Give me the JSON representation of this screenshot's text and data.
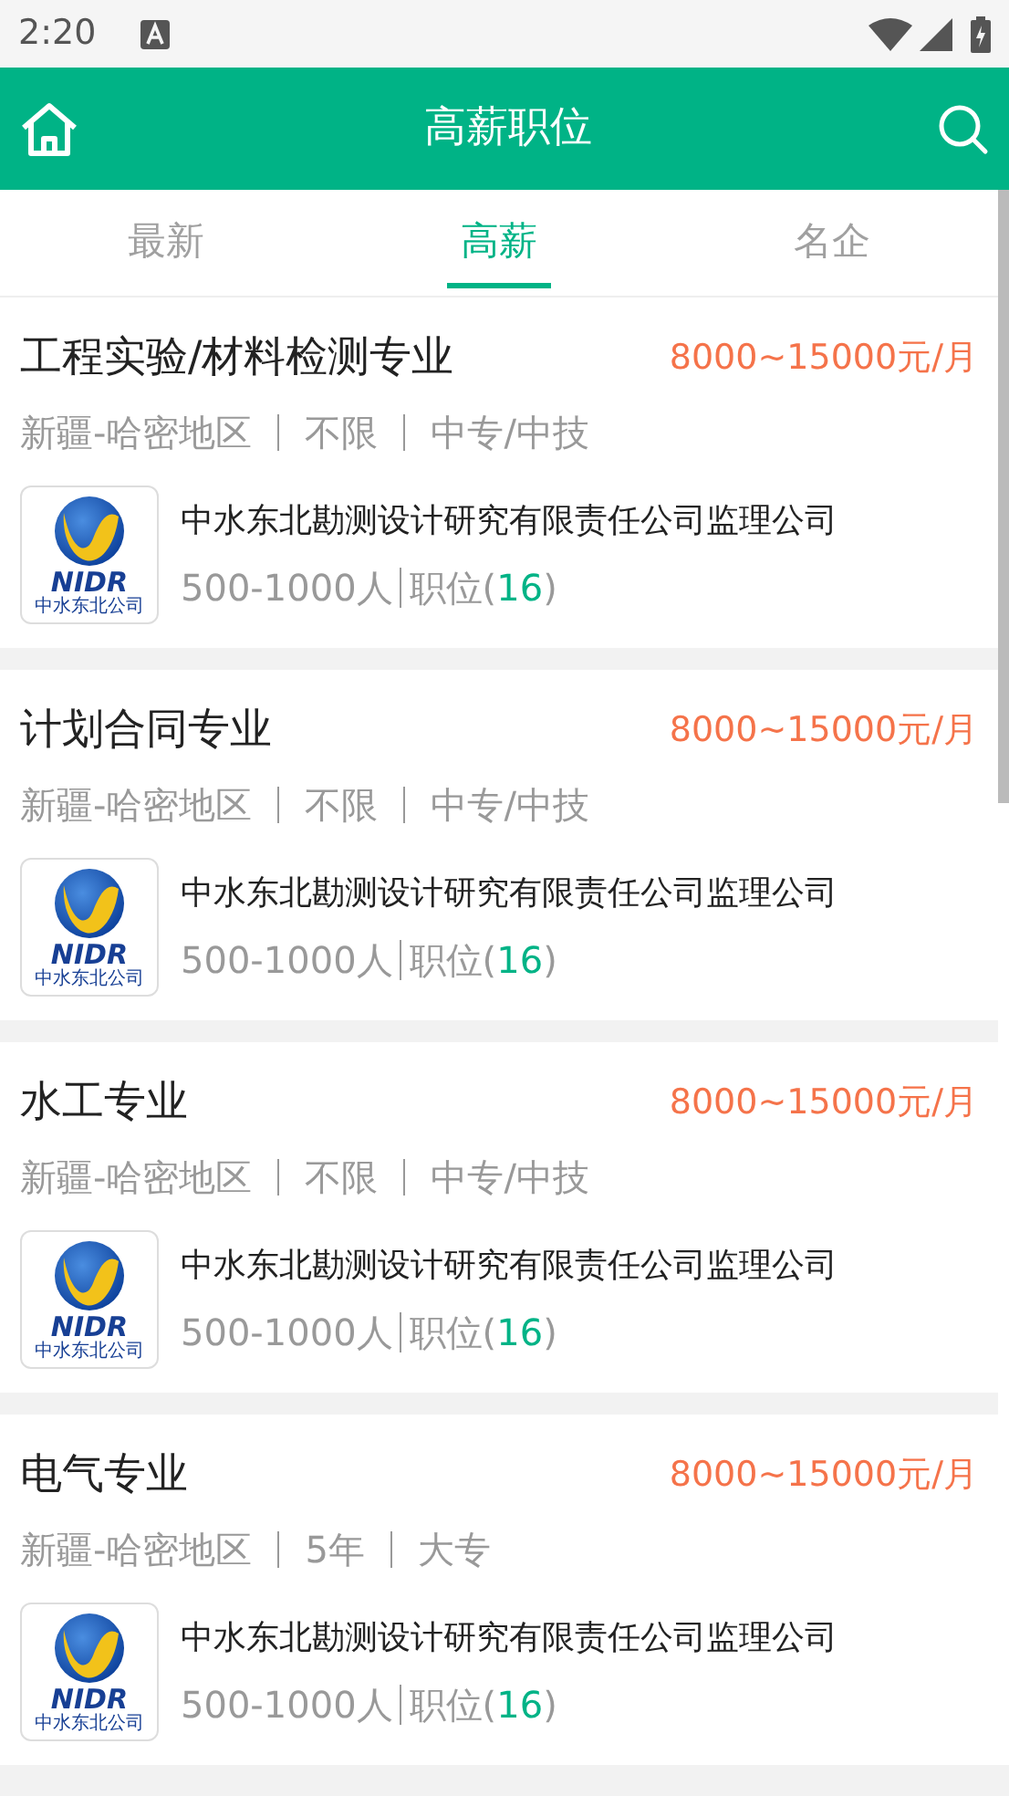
{
  "status_bar": {
    "time": "2:20"
  },
  "header": {
    "title": "高薪职位"
  },
  "tabs": [
    {
      "label": "最新",
      "selected": false
    },
    {
      "label": "高薪",
      "selected": true
    },
    {
      "label": "名企",
      "selected": false
    }
  ],
  "jobs": [
    {
      "title": "工程实验/材料检测专业",
      "salary": "8000~15000元/月",
      "meta": [
        "新疆-哈密地区",
        "不限",
        "中专/中技"
      ],
      "logo_text": "NIDR",
      "logo_subtext": "中水东北公司",
      "company": "中水东北勘测设计研究有限责任公司监理公司",
      "size": "500-1000人",
      "positions_prefix": "职位(",
      "positions_count": "16",
      "positions_suffix": ")"
    },
    {
      "title": "计划合同专业",
      "salary": "8000~15000元/月",
      "meta": [
        "新疆-哈密地区",
        "不限",
        "中专/中技"
      ],
      "logo_text": "NIDR",
      "logo_subtext": "中水东北公司",
      "company": "中水东北勘测设计研究有限责任公司监理公司",
      "size": "500-1000人",
      "positions_prefix": "职位(",
      "positions_count": "16",
      "positions_suffix": ")"
    },
    {
      "title": "水工专业",
      "salary": "8000~15000元/月",
      "meta": [
        "新疆-哈密地区",
        "不限",
        "中专/中技"
      ],
      "logo_text": "NIDR",
      "logo_subtext": "中水东北公司",
      "company": "中水东北勘测设计研究有限责任公司监理公司",
      "size": "500-1000人",
      "positions_prefix": "职位(",
      "positions_count": "16",
      "positions_suffix": ")"
    },
    {
      "title": "电气专业",
      "salary": "8000~15000元/月",
      "meta": [
        "新疆-哈密地区",
        "5年",
        "大专"
      ],
      "logo_text": "NIDR",
      "logo_subtext": "中水东北公司",
      "company": "中水东北勘测设计研究有限责任公司监理公司",
      "size": "500-1000人",
      "positions_prefix": "职位(",
      "positions_count": "16",
      "positions_suffix": ")"
    }
  ]
}
